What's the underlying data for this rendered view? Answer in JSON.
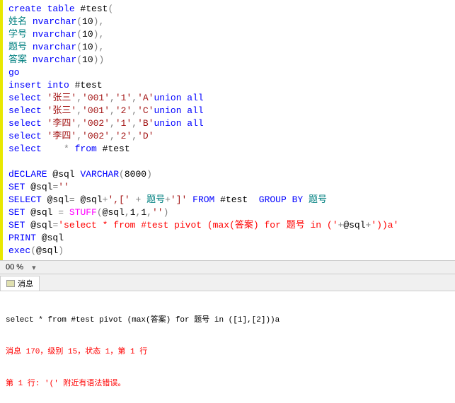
{
  "code_lines": [
    [
      {
        "t": "create table ",
        "c": "kw-blue"
      },
      {
        "t": "#test",
        "c": "black"
      },
      {
        "t": "(",
        "c": "gray"
      }
    ],
    [
      {
        "t": "姓名 ",
        "c": "kw-green"
      },
      {
        "t": "nvarchar",
        "c": "kw-blue"
      },
      {
        "t": "(",
        "c": "gray"
      },
      {
        "t": "10",
        "c": "black"
      },
      {
        "t": "),",
        "c": "gray"
      }
    ],
    [
      {
        "t": "学号 ",
        "c": "kw-green"
      },
      {
        "t": "nvarchar",
        "c": "kw-blue"
      },
      {
        "t": "(",
        "c": "gray"
      },
      {
        "t": "10",
        "c": "black"
      },
      {
        "t": "),",
        "c": "gray"
      }
    ],
    [
      {
        "t": "题号 ",
        "c": "kw-green"
      },
      {
        "t": "nvarchar",
        "c": "kw-blue"
      },
      {
        "t": "(",
        "c": "gray"
      },
      {
        "t": "10",
        "c": "black"
      },
      {
        "t": "),",
        "c": "gray"
      }
    ],
    [
      {
        "t": "答案 ",
        "c": "kw-green"
      },
      {
        "t": "nvarchar",
        "c": "kw-blue"
      },
      {
        "t": "(",
        "c": "gray"
      },
      {
        "t": "10",
        "c": "black"
      },
      {
        "t": "))",
        "c": "gray"
      }
    ],
    [
      {
        "t": "go",
        "c": "kw-blue"
      }
    ],
    [
      {
        "t": "insert into ",
        "c": "kw-blue"
      },
      {
        "t": "#test",
        "c": "black"
      }
    ],
    [
      {
        "t": "select ",
        "c": "kw-blue"
      },
      {
        "t": "'张三'",
        "c": "str-red"
      },
      {
        "t": ",",
        "c": "gray"
      },
      {
        "t": "'001'",
        "c": "str-red"
      },
      {
        "t": ",",
        "c": "gray"
      },
      {
        "t": "'1'",
        "c": "str-red"
      },
      {
        "t": ",",
        "c": "gray"
      },
      {
        "t": "'A'",
        "c": "str-red"
      },
      {
        "t": "union all",
        "c": "kw-blue"
      }
    ],
    [
      {
        "t": "select ",
        "c": "kw-blue"
      },
      {
        "t": "'张三'",
        "c": "str-red"
      },
      {
        "t": ",",
        "c": "gray"
      },
      {
        "t": "'001'",
        "c": "str-red"
      },
      {
        "t": ",",
        "c": "gray"
      },
      {
        "t": "'2'",
        "c": "str-red"
      },
      {
        "t": ",",
        "c": "gray"
      },
      {
        "t": "'C'",
        "c": "str-red"
      },
      {
        "t": "union all",
        "c": "kw-blue"
      }
    ],
    [
      {
        "t": "select ",
        "c": "kw-blue"
      },
      {
        "t": "'李四'",
        "c": "str-red"
      },
      {
        "t": ",",
        "c": "gray"
      },
      {
        "t": "'002'",
        "c": "str-red"
      },
      {
        "t": ",",
        "c": "gray"
      },
      {
        "t": "'1'",
        "c": "str-red"
      },
      {
        "t": ",",
        "c": "gray"
      },
      {
        "t": "'B'",
        "c": "str-red"
      },
      {
        "t": "union all",
        "c": "kw-blue"
      }
    ],
    [
      {
        "t": "select ",
        "c": "kw-blue"
      },
      {
        "t": "'李四'",
        "c": "str-red"
      },
      {
        "t": ",",
        "c": "gray"
      },
      {
        "t": "'002'",
        "c": "str-red"
      },
      {
        "t": ",",
        "c": "gray"
      },
      {
        "t": "'2'",
        "c": "str-red"
      },
      {
        "t": ",",
        "c": "gray"
      },
      {
        "t": "'D'",
        "c": "str-red"
      }
    ],
    [
      {
        "t": "select    ",
        "c": "kw-blue"
      },
      {
        "t": "* ",
        "c": "gray"
      },
      {
        "t": "from ",
        "c": "kw-blue"
      },
      {
        "t": "#test",
        "c": "black"
      }
    ],
    [
      {
        "t": "",
        "c": ""
      }
    ],
    [
      {
        "t": "dECLARE ",
        "c": "kw-blue"
      },
      {
        "t": "@sql ",
        "c": "black"
      },
      {
        "t": "VARCHAR",
        "c": "kw-blue"
      },
      {
        "t": "(",
        "c": "gray"
      },
      {
        "t": "8000",
        "c": "black"
      },
      {
        "t": ")",
        "c": "gray"
      }
    ],
    [
      {
        "t": "SET ",
        "c": "kw-blue"
      },
      {
        "t": "@sql",
        "c": "black"
      },
      {
        "t": "=",
        "c": "gray"
      },
      {
        "t": "''",
        "c": "str-red"
      }
    ],
    [
      {
        "t": "SELECT ",
        "c": "kw-blue"
      },
      {
        "t": "@sql",
        "c": "black"
      },
      {
        "t": "= ",
        "c": "gray"
      },
      {
        "t": "@sql",
        "c": "black"
      },
      {
        "t": "+",
        "c": "gray"
      },
      {
        "t": "',[' ",
        "c": "str-red"
      },
      {
        "t": "+ ",
        "c": "gray"
      },
      {
        "t": "题号",
        "c": "kw-green"
      },
      {
        "t": "+",
        "c": "gray"
      },
      {
        "t": "']' ",
        "c": "str-red"
      },
      {
        "t": "FROM ",
        "c": "kw-blue"
      },
      {
        "t": "#test  ",
        "c": "black"
      },
      {
        "t": "GROUP BY ",
        "c": "kw-blue"
      },
      {
        "t": "题号",
        "c": "kw-green"
      }
    ],
    [
      {
        "t": "SET ",
        "c": "kw-blue"
      },
      {
        "t": "@sql ",
        "c": "black"
      },
      {
        "t": "= ",
        "c": "gray"
      },
      {
        "t": "STUFF",
        "c": "func-pink"
      },
      {
        "t": "(",
        "c": "gray"
      },
      {
        "t": "@sql",
        "c": "black"
      },
      {
        "t": ",",
        "c": "gray"
      },
      {
        "t": "1",
        "c": "black"
      },
      {
        "t": ",",
        "c": "gray"
      },
      {
        "t": "1",
        "c": "black"
      },
      {
        "t": ",",
        "c": "gray"
      },
      {
        "t": "''",
        "c": "str-red"
      },
      {
        "t": ")",
        "c": "gray"
      }
    ],
    [
      {
        "t": "SET ",
        "c": "kw-blue"
      },
      {
        "t": "@sql",
        "c": "black"
      },
      {
        "t": "=",
        "c": "gray"
      },
      {
        "t": "'select * from #test pivot (max(答案) for 题号 in ('",
        "c": "str-red2"
      },
      {
        "t": "+",
        "c": "gray"
      },
      {
        "t": "@sql",
        "c": "black"
      },
      {
        "t": "+",
        "c": "gray"
      },
      {
        "t": "'))a'",
        "c": "str-red2"
      }
    ],
    [
      {
        "t": "PRINT ",
        "c": "kw-blue"
      },
      {
        "t": "@sql",
        "c": "black"
      }
    ],
    [
      {
        "t": "exec",
        "c": "kw-blue"
      },
      {
        "t": "(",
        "c": "gray"
      },
      {
        "t": "@sql",
        "c": "black"
      },
      {
        "t": ")",
        "c": "gray"
      }
    ]
  ],
  "zoom": "00 %",
  "tab_label": "消息",
  "results": {
    "line1": "select * from #test pivot (max(答案) for 题号 in ([1],[2]))a",
    "line2": "消息 170，级别 15，状态 1，第 1 行",
    "line3": "第 1 行: '(' 附近有语法错误。"
  }
}
